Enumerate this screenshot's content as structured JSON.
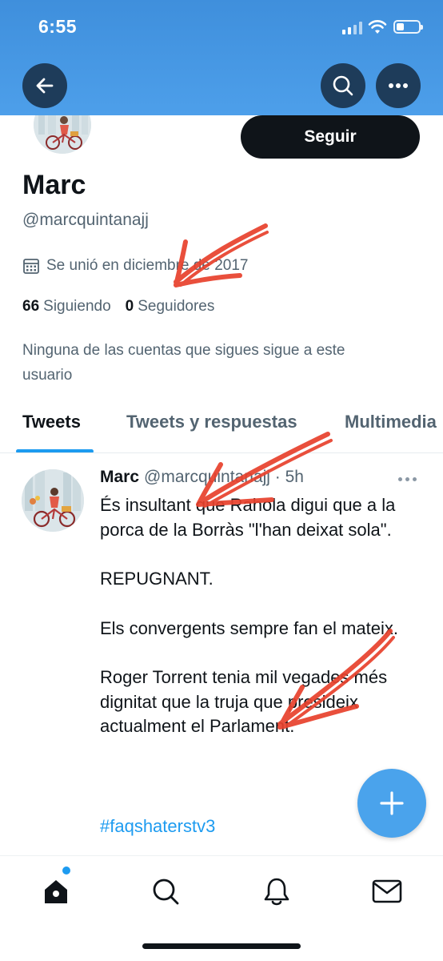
{
  "status_bar": {
    "time": "6:55",
    "battery_level": 0.35
  },
  "header": {
    "back_icon": "arrow-left-icon",
    "search_icon": "search-icon",
    "more_icon": "more-horizontal-icon"
  },
  "profile": {
    "follow_label": "Seguir",
    "name": "Marc",
    "handle": "@marcquintanajj",
    "joined": "Se unió en diciembre de 2017",
    "following_count": "66",
    "following_label": "Siguiendo",
    "followers_count": "0",
    "followers_label": "Seguidores",
    "note": "Ninguna de las cuentas que sigues sigue a este usuario"
  },
  "tabs": [
    {
      "label": "Tweets",
      "active": true
    },
    {
      "label": "Tweets y respuestas",
      "active": false
    },
    {
      "label": "Multimedia",
      "active": false
    }
  ],
  "tweet": {
    "name": "Marc",
    "handle": "@marcquintanajj",
    "separator": "·",
    "time": "5h",
    "paragraphs": [
      "És insultant que Rahola digui que a la porca de la Borràs \"l'han deixat sola\".",
      "REPUGNANT.",
      "Els convergents sempre fan el mateix.",
      "Roger Torrent tenia mil vegades més dignitat que la truja que presideix actualment el Parlament."
    ],
    "hashtag": "#faqshaterstv3"
  },
  "fab": {
    "icon": "plus-icon"
  },
  "bottom_nav": [
    {
      "icon": "home-icon"
    },
    {
      "icon": "search-icon"
    },
    {
      "icon": "bell-icon"
    },
    {
      "icon": "mail-icon"
    }
  ],
  "colors": {
    "header": "#4d9fea",
    "accent": "#1d9bf0",
    "text": "#0f1419",
    "muted": "#536471",
    "annotation_arrow": "#e8412c"
  }
}
